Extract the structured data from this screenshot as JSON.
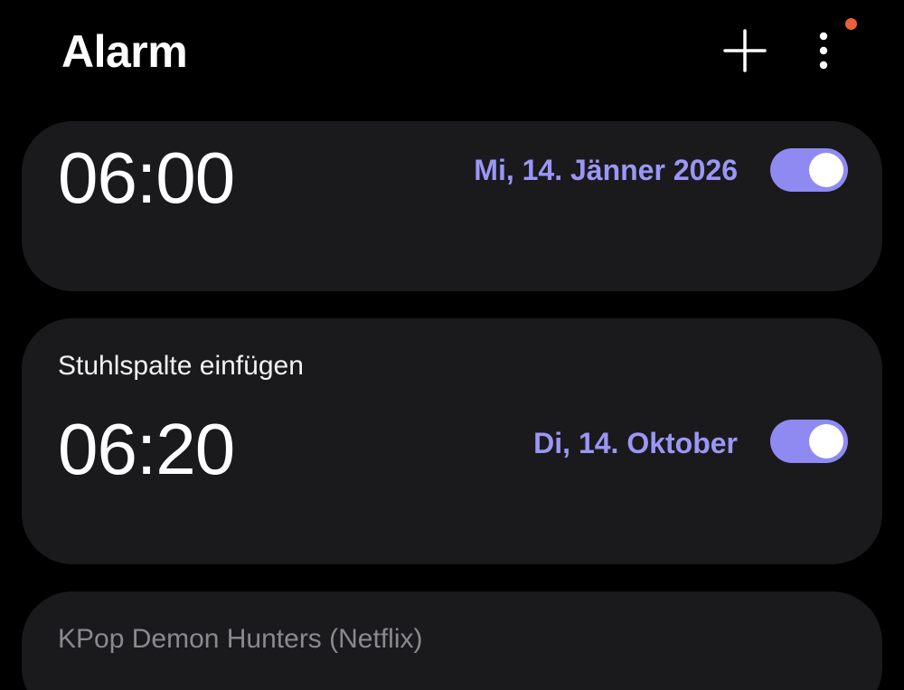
{
  "header": {
    "title": "Alarm",
    "add_icon": "plus-icon",
    "more_icon": "more-vertical-icon",
    "notification_dot_color": "#e8613a"
  },
  "colors": {
    "accent": "#9b96f6",
    "toggle_on": "#8f8af2",
    "card_bg": "#1a1a1d",
    "disabled_label": "#8a8a8e"
  },
  "alarms": [
    {
      "label": "",
      "time": "06:00",
      "date": "Mi, 14. Jänner 2026",
      "enabled": true
    },
    {
      "label": "Stuhlspalte einfügen",
      "time": "06:20",
      "date": "Di, 14. Oktober",
      "enabled": true
    },
    {
      "label": "KPop Demon Hunters (Netflix)"
    }
  ]
}
